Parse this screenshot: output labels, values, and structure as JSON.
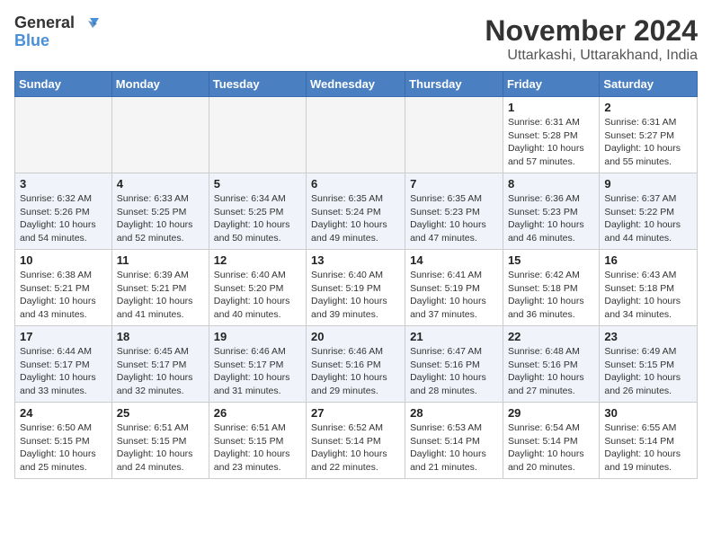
{
  "logo": {
    "line1": "General",
    "line2": "Blue"
  },
  "title": "November 2024",
  "location": "Uttarkashi, Uttarakhand, India",
  "weekdays": [
    "Sunday",
    "Monday",
    "Tuesday",
    "Wednesday",
    "Thursday",
    "Friday",
    "Saturday"
  ],
  "weeks": [
    [
      {
        "day": "",
        "info": ""
      },
      {
        "day": "",
        "info": ""
      },
      {
        "day": "",
        "info": ""
      },
      {
        "day": "",
        "info": ""
      },
      {
        "day": "",
        "info": ""
      },
      {
        "day": "1",
        "info": "Sunrise: 6:31 AM\nSunset: 5:28 PM\nDaylight: 10 hours\nand 57 minutes."
      },
      {
        "day": "2",
        "info": "Sunrise: 6:31 AM\nSunset: 5:27 PM\nDaylight: 10 hours\nand 55 minutes."
      }
    ],
    [
      {
        "day": "3",
        "info": "Sunrise: 6:32 AM\nSunset: 5:26 PM\nDaylight: 10 hours\nand 54 minutes."
      },
      {
        "day": "4",
        "info": "Sunrise: 6:33 AM\nSunset: 5:25 PM\nDaylight: 10 hours\nand 52 minutes."
      },
      {
        "day": "5",
        "info": "Sunrise: 6:34 AM\nSunset: 5:25 PM\nDaylight: 10 hours\nand 50 minutes."
      },
      {
        "day": "6",
        "info": "Sunrise: 6:35 AM\nSunset: 5:24 PM\nDaylight: 10 hours\nand 49 minutes."
      },
      {
        "day": "7",
        "info": "Sunrise: 6:35 AM\nSunset: 5:23 PM\nDaylight: 10 hours\nand 47 minutes."
      },
      {
        "day": "8",
        "info": "Sunrise: 6:36 AM\nSunset: 5:23 PM\nDaylight: 10 hours\nand 46 minutes."
      },
      {
        "day": "9",
        "info": "Sunrise: 6:37 AM\nSunset: 5:22 PM\nDaylight: 10 hours\nand 44 minutes."
      }
    ],
    [
      {
        "day": "10",
        "info": "Sunrise: 6:38 AM\nSunset: 5:21 PM\nDaylight: 10 hours\nand 43 minutes."
      },
      {
        "day": "11",
        "info": "Sunrise: 6:39 AM\nSunset: 5:21 PM\nDaylight: 10 hours\nand 41 minutes."
      },
      {
        "day": "12",
        "info": "Sunrise: 6:40 AM\nSunset: 5:20 PM\nDaylight: 10 hours\nand 40 minutes."
      },
      {
        "day": "13",
        "info": "Sunrise: 6:40 AM\nSunset: 5:19 PM\nDaylight: 10 hours\nand 39 minutes."
      },
      {
        "day": "14",
        "info": "Sunrise: 6:41 AM\nSunset: 5:19 PM\nDaylight: 10 hours\nand 37 minutes."
      },
      {
        "day": "15",
        "info": "Sunrise: 6:42 AM\nSunset: 5:18 PM\nDaylight: 10 hours\nand 36 minutes."
      },
      {
        "day": "16",
        "info": "Sunrise: 6:43 AM\nSunset: 5:18 PM\nDaylight: 10 hours\nand 34 minutes."
      }
    ],
    [
      {
        "day": "17",
        "info": "Sunrise: 6:44 AM\nSunset: 5:17 PM\nDaylight: 10 hours\nand 33 minutes."
      },
      {
        "day": "18",
        "info": "Sunrise: 6:45 AM\nSunset: 5:17 PM\nDaylight: 10 hours\nand 32 minutes."
      },
      {
        "day": "19",
        "info": "Sunrise: 6:46 AM\nSunset: 5:17 PM\nDaylight: 10 hours\nand 31 minutes."
      },
      {
        "day": "20",
        "info": "Sunrise: 6:46 AM\nSunset: 5:16 PM\nDaylight: 10 hours\nand 29 minutes."
      },
      {
        "day": "21",
        "info": "Sunrise: 6:47 AM\nSunset: 5:16 PM\nDaylight: 10 hours\nand 28 minutes."
      },
      {
        "day": "22",
        "info": "Sunrise: 6:48 AM\nSunset: 5:16 PM\nDaylight: 10 hours\nand 27 minutes."
      },
      {
        "day": "23",
        "info": "Sunrise: 6:49 AM\nSunset: 5:15 PM\nDaylight: 10 hours\nand 26 minutes."
      }
    ],
    [
      {
        "day": "24",
        "info": "Sunrise: 6:50 AM\nSunset: 5:15 PM\nDaylight: 10 hours\nand 25 minutes."
      },
      {
        "day": "25",
        "info": "Sunrise: 6:51 AM\nSunset: 5:15 PM\nDaylight: 10 hours\nand 24 minutes."
      },
      {
        "day": "26",
        "info": "Sunrise: 6:51 AM\nSunset: 5:15 PM\nDaylight: 10 hours\nand 23 minutes."
      },
      {
        "day": "27",
        "info": "Sunrise: 6:52 AM\nSunset: 5:14 PM\nDaylight: 10 hours\nand 22 minutes."
      },
      {
        "day": "28",
        "info": "Sunrise: 6:53 AM\nSunset: 5:14 PM\nDaylight: 10 hours\nand 21 minutes."
      },
      {
        "day": "29",
        "info": "Sunrise: 6:54 AM\nSunset: 5:14 PM\nDaylight: 10 hours\nand 20 minutes."
      },
      {
        "day": "30",
        "info": "Sunrise: 6:55 AM\nSunset: 5:14 PM\nDaylight: 10 hours\nand 19 minutes."
      }
    ]
  ]
}
